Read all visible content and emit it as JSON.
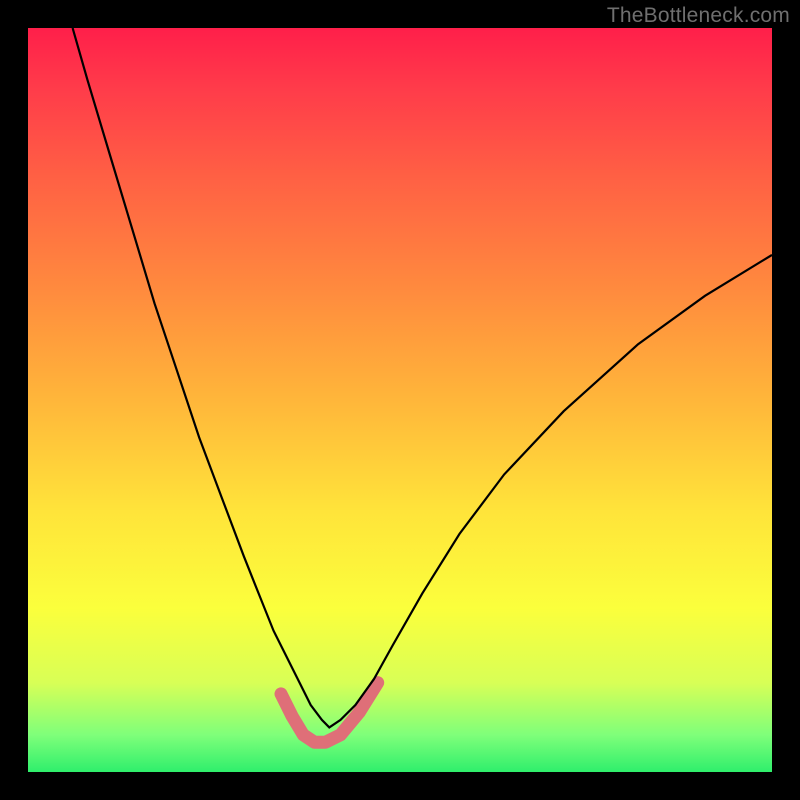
{
  "watermark": {
    "text": "TheBottleneck.com"
  },
  "chart_data": {
    "type": "line",
    "title": "",
    "xlabel": "",
    "ylabel": "",
    "xlim": [
      0,
      1
    ],
    "ylim": [
      0,
      1
    ],
    "gradient_stops": [
      {
        "pos": 0.0,
        "color": "#ff1f4a"
      },
      {
        "pos": 0.08,
        "color": "#ff3b4a"
      },
      {
        "pos": 0.2,
        "color": "#ff6044"
      },
      {
        "pos": 0.35,
        "color": "#ff8a3e"
      },
      {
        "pos": 0.5,
        "color": "#ffb63a"
      },
      {
        "pos": 0.65,
        "color": "#ffe43a"
      },
      {
        "pos": 0.78,
        "color": "#fbff3c"
      },
      {
        "pos": 0.88,
        "color": "#d8ff56"
      },
      {
        "pos": 0.95,
        "color": "#7fff7a"
      },
      {
        "pos": 1.0,
        "color": "#2fef6c"
      }
    ],
    "series": [
      {
        "name": "black-curve",
        "stroke": "#000000",
        "stroke_width": 2.2,
        "x": [
          0.06,
          0.08,
          0.11,
          0.14,
          0.17,
          0.2,
          0.23,
          0.26,
          0.29,
          0.31,
          0.33,
          0.35,
          0.365,
          0.38,
          0.395,
          0.405,
          0.42,
          0.44,
          0.465,
          0.49,
          0.53,
          0.58,
          0.64,
          0.72,
          0.82,
          0.91,
          1.0
        ],
        "y": [
          1.0,
          0.93,
          0.83,
          0.73,
          0.63,
          0.54,
          0.45,
          0.37,
          0.29,
          0.24,
          0.19,
          0.15,
          0.12,
          0.09,
          0.07,
          0.06,
          0.07,
          0.09,
          0.125,
          0.17,
          0.24,
          0.32,
          0.4,
          0.485,
          0.575,
          0.64,
          0.695
        ]
      },
      {
        "name": "pink-flat",
        "stroke": "#df6f78",
        "stroke_width": 13,
        "linecap": "round",
        "x": [
          0.34,
          0.355,
          0.37,
          0.385,
          0.4,
          0.42,
          0.445,
          0.47
        ],
        "y": [
          0.105,
          0.075,
          0.05,
          0.04,
          0.04,
          0.05,
          0.08,
          0.12
        ]
      }
    ]
  }
}
